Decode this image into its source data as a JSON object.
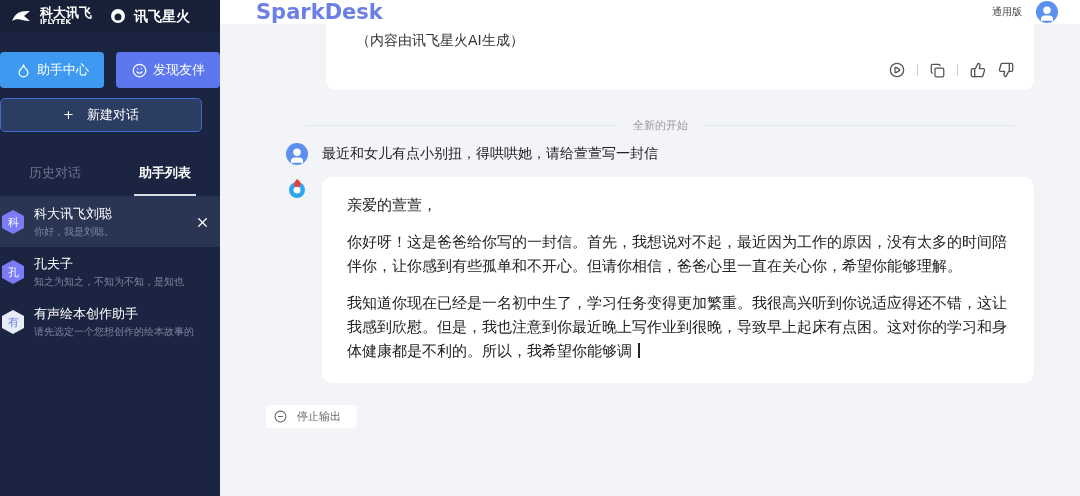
{
  "sidebar": {
    "logo": {
      "brand": "科大讯飞",
      "brand_en": "IFLYTEK",
      "product": "讯飞星火"
    },
    "buttons": [
      {
        "label": "助手中心",
        "kind": "center"
      },
      {
        "label": "发现友伴",
        "kind": "discover"
      }
    ],
    "new_chat": {
      "label": "新建对话",
      "icon": "+"
    },
    "tabs": [
      {
        "label": "历史对话",
        "selected": false
      },
      {
        "label": "助手列表",
        "selected": true
      }
    ],
    "assistants": [
      {
        "avatar": "科",
        "name": "科大讯飞刘聪",
        "intro": "你好，我是刘聪。",
        "selected": true,
        "color": "#7a7cf5"
      },
      {
        "avatar": "孔",
        "name": "孔夫子",
        "intro": "知之为知之，不知为不知，是知也",
        "selected": false,
        "color": "#7a7cf5"
      },
      {
        "avatar": "有",
        "name": "有声绘本创作助手",
        "intro": "请先选定一个您想创作的绘本故事的",
        "selected": false,
        "color": "#e8ecf8"
      }
    ]
  },
  "header": {
    "title": "SparkDesk",
    "edition": "通用版"
  },
  "previous_answer": {
    "text": "（内容由讯飞星火AI生成）"
  },
  "divider": "全新的开始",
  "question": "最近和女儿有点小别扭，得哄哄她，请给萱萱写一封信",
  "answer": {
    "paragraphs": [
      "亲爱的萱萱，",
      "你好呀！这是爸爸给你写的一封信。首先，我想说对不起，最近因为工作的原因，没有太多的时间陪伴你，让你感到有些孤单和不开心。但请你相信，爸爸心里一直在关心你，希望你能够理解。",
      "我知道你现在已经是一名初中生了，学习任务变得更加繁重。我很高兴听到你说适应得还不错，这让我感到欣慰。但是，我也注意到你最近晚上写作业到很晚，导致早上起床有点困。这对你的学习和身体健康都是不利的。所以，我希望你能够调"
    ],
    "streaming": true
  },
  "stop_button": "停止输出"
}
